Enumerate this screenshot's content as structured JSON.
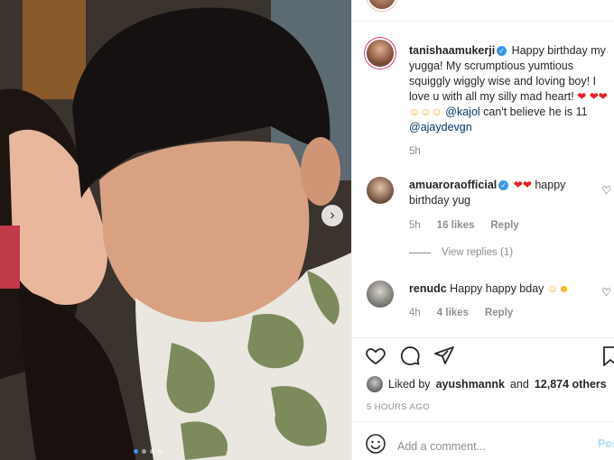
{
  "post": {
    "image_description_icon": "photo",
    "carousel": {
      "slides": 4,
      "active": 1,
      "next_icon": "chevron-right-icon"
    }
  },
  "caption": {
    "username": "tanishaamukerji",
    "text_1": "Happy birthday my yugga! My scrumptious yumtious squiggly wiggly wise and loving boy! I love u with all my silly mad heart!",
    "mention_1": "@kajol",
    "text_2": "can't believe he is 11",
    "mention_2": "@ajaydevgn",
    "time": "5h"
  },
  "comments": [
    {
      "username": "amuaroraofficial",
      "text": "happy birthday yug",
      "time": "5h",
      "likes": "16 likes",
      "reply": "Reply",
      "view_replies": "View replies (1)"
    },
    {
      "username": "renudc",
      "text": "Happy happy bday",
      "time": "4h",
      "likes": "4 likes",
      "reply": "Reply"
    }
  ],
  "likes": {
    "prefix": "Liked by",
    "user": "ayushmannk",
    "joiner": "and",
    "count": "12,874 others"
  },
  "timestamp": "5 HOURS AGO",
  "add_comment": {
    "placeholder": "Add a comment...",
    "post_label": "Post"
  },
  "colors": {
    "link": "#00376b",
    "meta": "#8e8e8e",
    "blue": "#3897f0",
    "heart": "#ed1c24"
  }
}
